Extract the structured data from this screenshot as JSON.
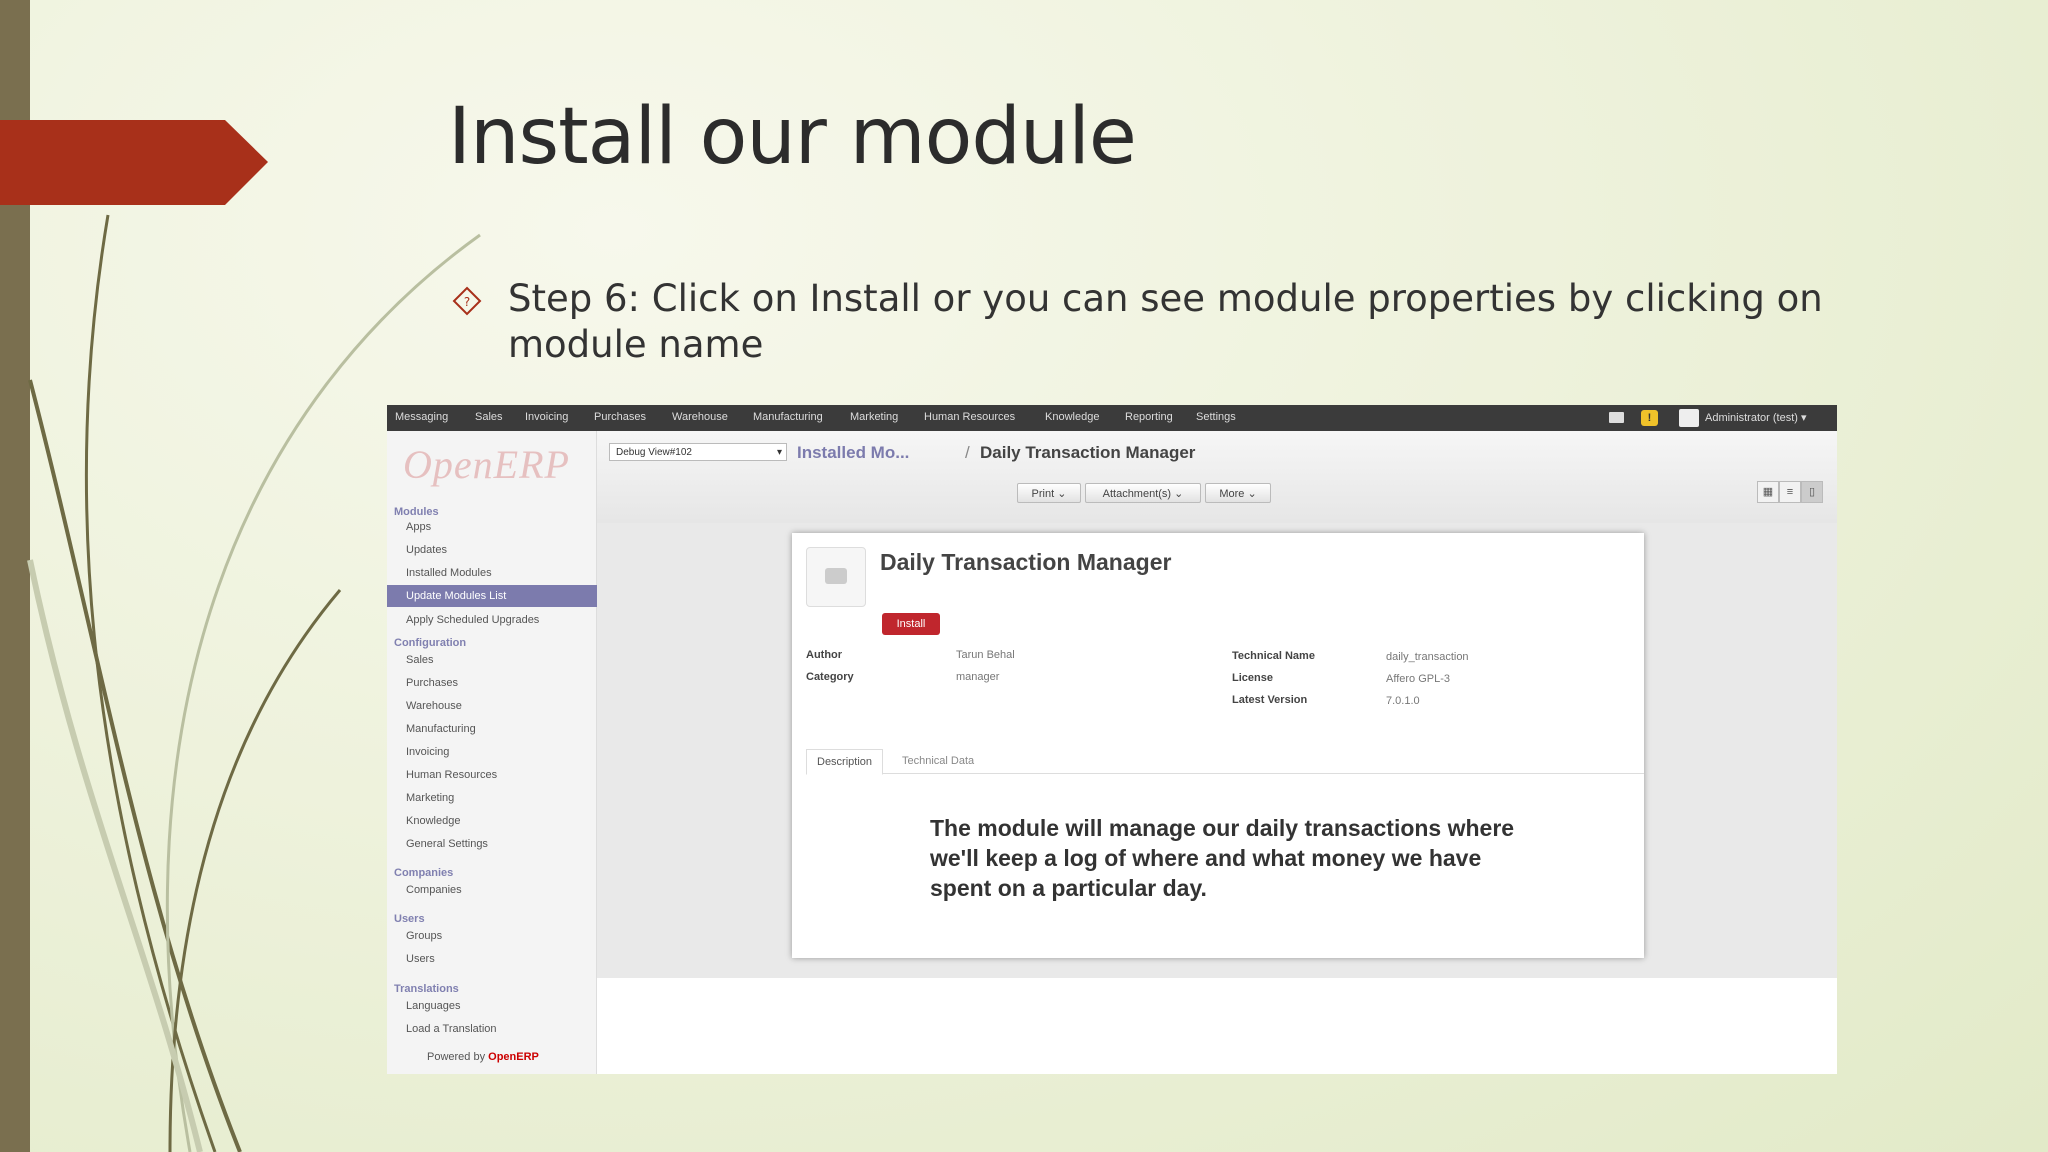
{
  "slide": {
    "title": "Install our module",
    "bullet": "Step 6: Click on Install or you can see module properties by clicking on module name"
  },
  "colors": {
    "accent": "#a8301a",
    "bar": "#7a6f4f",
    "active_menu": "#7c7bad",
    "install": "#c0262d"
  },
  "app": {
    "top_nav": [
      "Messaging",
      "Sales",
      "Invoicing",
      "Purchases",
      "Warehouse",
      "Manufacturing",
      "Marketing",
      "Human Resources",
      "Knowledge",
      "Reporting",
      "Settings"
    ],
    "alert_icon": "!",
    "user_menu": "Administrator (test) ▾",
    "logo": "OpenERP",
    "sidebar": {
      "modules_heading": "Modules",
      "modules": [
        "Apps",
        "Updates",
        "Installed Modules",
        "Update Modules List",
        "Apply Scheduled Upgrades"
      ],
      "configuration_heading": "Configuration",
      "configuration": [
        "Sales",
        "Purchases",
        "Warehouse",
        "Manufacturing",
        "Invoicing",
        "Human Resources",
        "Marketing",
        "Knowledge",
        "General Settings"
      ],
      "companies_heading": "Companies",
      "companies": [
        "Companies"
      ],
      "users_heading": "Users",
      "users": [
        "Groups",
        "Users"
      ],
      "translations_heading": "Translations",
      "translations": [
        "Languages",
        "Load a Translation"
      ],
      "powered_prefix": "Powered by",
      "powered_brand": "OpenERP"
    },
    "toolbar": {
      "debug_select": "Debug View#102",
      "breadcrumb_link": "Installed Mo...",
      "breadcrumb_sep": "/",
      "breadcrumb_current": "Daily Transaction Manager",
      "print": "Print ⌄",
      "attachments": "Attachment(s) ⌄",
      "more": "More ⌄"
    },
    "form": {
      "name": "Daily Transaction Manager",
      "install_label": "Install",
      "author_label": "Author",
      "author": "Tarun Behal",
      "category_label": "Category",
      "category": "manager",
      "technical_name_label": "Technical Name",
      "technical_name": "daily_transaction",
      "license_label": "License",
      "license": "Affero GPL-3",
      "version_label": "Latest Version",
      "version": "7.0.1.0",
      "tab_description": "Description",
      "tab_technical": "Technical Data",
      "description": "The module will manage our daily transactions where we'll keep a log of where and what money we have spent on a particular day."
    }
  }
}
